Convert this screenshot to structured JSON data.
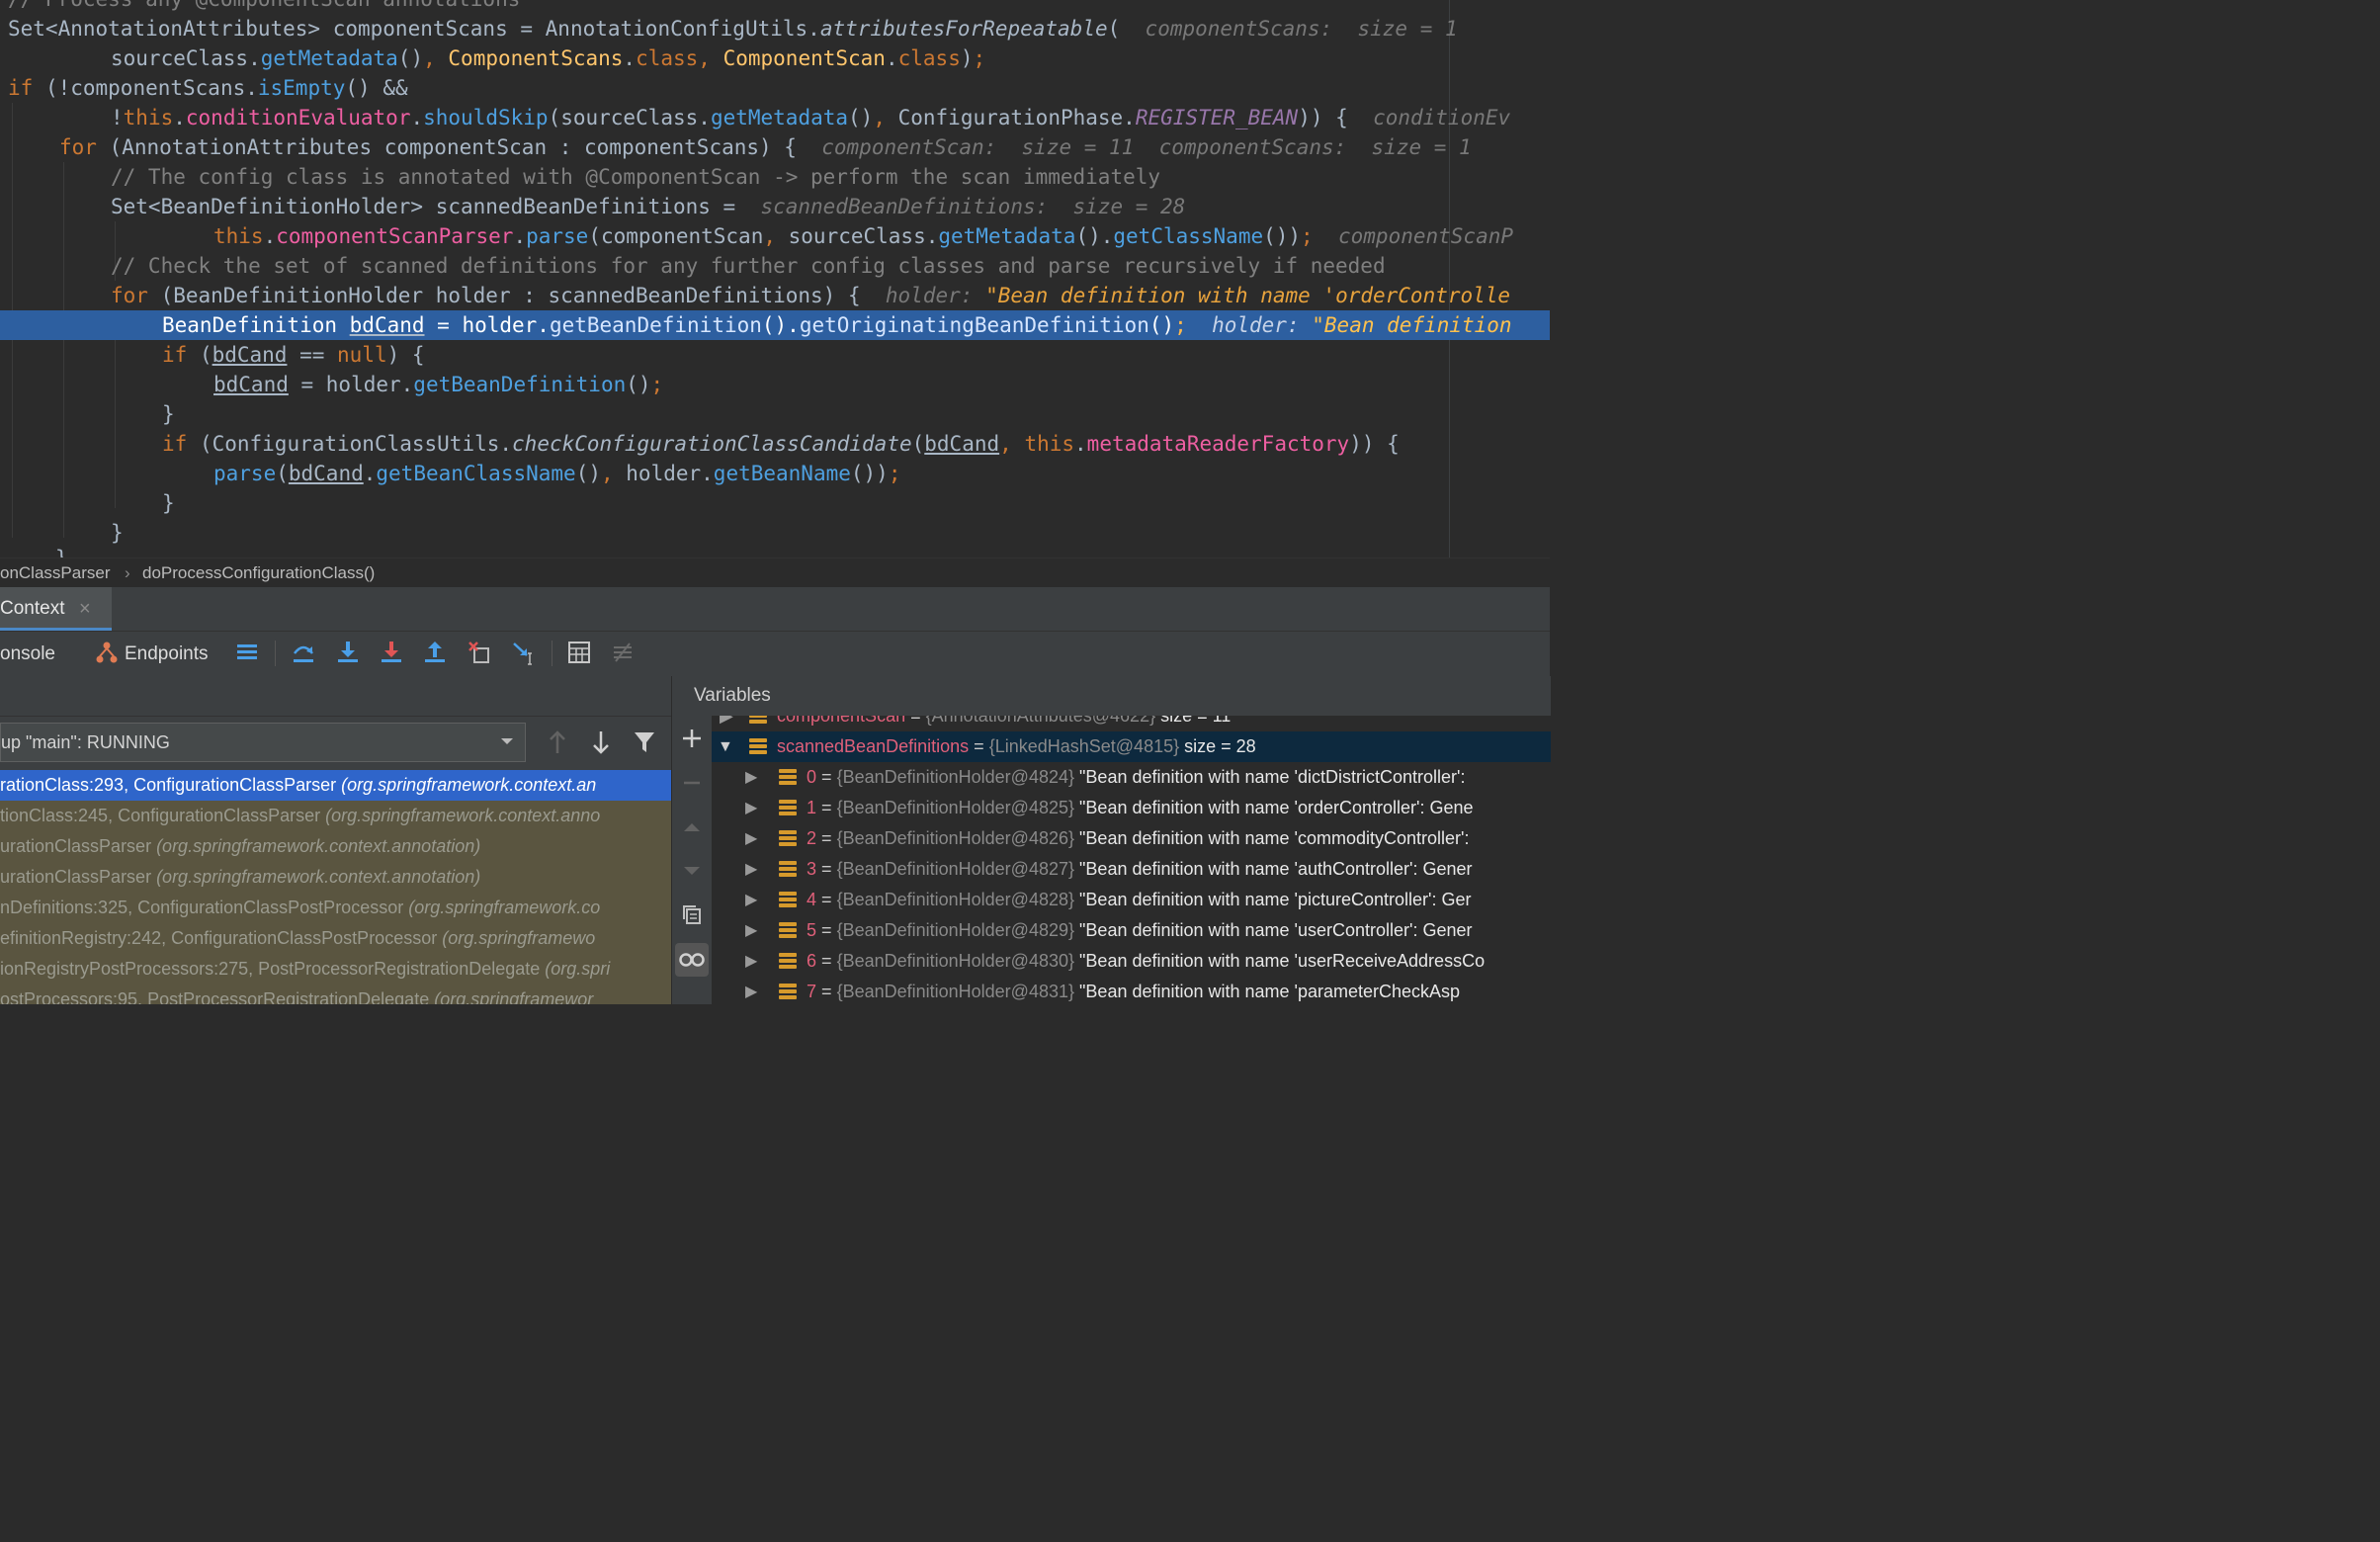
{
  "editor": {
    "code_lines": [
      "// Process any @ComponentScan annotations",
      "Set<AnnotationAttributes> componentScans = AnnotationConfigUtils.attributesForRepeatable(",
      "sourceClass.getMetadata(), ComponentScans.class, ComponentScan.class);",
      "if (!componentScans.isEmpty() &&",
      "!this.conditionEvaluator.shouldSkip(sourceClass.getMetadata(), ConfigurationPhase.REGISTER_BEAN)) {",
      "for (AnnotationAttributes componentScan : componentScans) {",
      "// The config class is annotated with @ComponentScan -> perform the scan immediately",
      "Set<BeanDefinitionHolder> scannedBeanDefinitions =",
      "this.componentScanParser.parse(componentScan, sourceClass.getMetadata().getClassName());",
      "// Check the set of scanned definitions for any further config classes and parse recursively if needed",
      "for (BeanDefinitionHolder holder : scannedBeanDefinitions) {",
      "BeanDefinition bdCand = holder.getBeanDefinition().getOriginatingBeanDefinition();",
      "if (bdCand == null) {",
      "bdCand = holder.getBeanDefinition();",
      "}",
      "if (ConfigurationClassUtils.checkConfigurationClassCandidate(bdCand, this.metadataReaderFactory)) {",
      "parse(bdCand.getBeanClassName(), holder.getBeanName());",
      "}",
      "}",
      "}"
    ],
    "inline_hints": {
      "component_scans": "componentScans:  size = 1",
      "condition": "conditionEv",
      "component_scan": "componentScan:  size = 11",
      "component_scans_2": "componentScans:  size = 1",
      "scanned": "scannedBeanDefinitions:  size = 28",
      "parser": "componentScanP",
      "holder_label": "holder:",
      "holder_value": "\"Bean definition with name 'orderControlle",
      "holder_label_2": "holder:",
      "holder_value_2": "\"Bean definition"
    }
  },
  "breadcrumb": {
    "class": "onClassParser",
    "separator": "›",
    "method": "doProcessConfigurationClass()"
  },
  "debug_tab": {
    "label": "Context",
    "close": "×"
  },
  "toolbar": {
    "console": "onsole",
    "endpoints": "Endpoints"
  },
  "frames": {
    "thread": "up \"main\": RUNNING",
    "rows": [
      {
        "method": "rationClass:293, ConfigurationClassParser ",
        "pkg": "(org.springframework.context.an"
      },
      {
        "method": "tionClass:245, ConfigurationClassParser ",
        "pkg": "(org.springframework.context.anno"
      },
      {
        "method": "urationClassParser ",
        "pkg": "(org.springframework.context.annotation)"
      },
      {
        "method": "urationClassParser ",
        "pkg": "(org.springframework.context.annotation)"
      },
      {
        "method": "nDefinitions:325, ConfigurationClassPostProcessor ",
        "pkg": "(org.springframework.co"
      },
      {
        "method": "efinitionRegistry:242, ConfigurationClassPostProcessor ",
        "pkg": "(org.springframewo"
      },
      {
        "method": "ionRegistryPostProcessors:275, PostProcessorRegistrationDelegate ",
        "pkg": "(org.spri"
      },
      {
        "method": "ostProcessors:95, PostProcessorRegistrationDelegate ",
        "pkg": "(org.springframewor"
      }
    ]
  },
  "variables": {
    "title": "Variables",
    "partial_row": {
      "name": "componentScan",
      "eq": "=",
      "type": "{AnnotationAttributes@4622}",
      "size": "size = 11"
    },
    "selected": {
      "name": "scannedBeanDefinitions",
      "eq": "=",
      "type": "{LinkedHashSet@4815}",
      "size": "size = 28"
    },
    "items": [
      {
        "index": "0",
        "type": "{BeanDefinitionHolder@4824}",
        "value": "\"Bean definition with name 'dictDistrictController': "
      },
      {
        "index": "1",
        "type": "{BeanDefinitionHolder@4825}",
        "value": "\"Bean definition with name 'orderController': Gene"
      },
      {
        "index": "2",
        "type": "{BeanDefinitionHolder@4826}",
        "value": "\"Bean definition with name 'commodityController':"
      },
      {
        "index": "3",
        "type": "{BeanDefinitionHolder@4827}",
        "value": "\"Bean definition with name 'authController': Gener"
      },
      {
        "index": "4",
        "type": "{BeanDefinitionHolder@4828}",
        "value": "\"Bean definition with name 'pictureController': Ger"
      },
      {
        "index": "5",
        "type": "{BeanDefinitionHolder@4829}",
        "value": "\"Bean definition with name 'userController': Gener"
      },
      {
        "index": "6",
        "type": "{BeanDefinitionHolder@4830}",
        "value": "\"Bean definition with name 'userReceiveAddressCo"
      },
      {
        "index": "7",
        "type": "{BeanDefinitionHolder@4831}",
        "value": "\"Bean definition with name 'parameterCheckAsp"
      }
    ],
    "eq": "="
  },
  "colors": {
    "editor_bg": "#2b2b2b",
    "exec_line": "#2d5fa0",
    "keyword": "#cc7832",
    "method": "#4ea0e0",
    "field": "#ee5fa2",
    "selected_frame": "#2f65ca",
    "variable_name": "#e0607a"
  }
}
